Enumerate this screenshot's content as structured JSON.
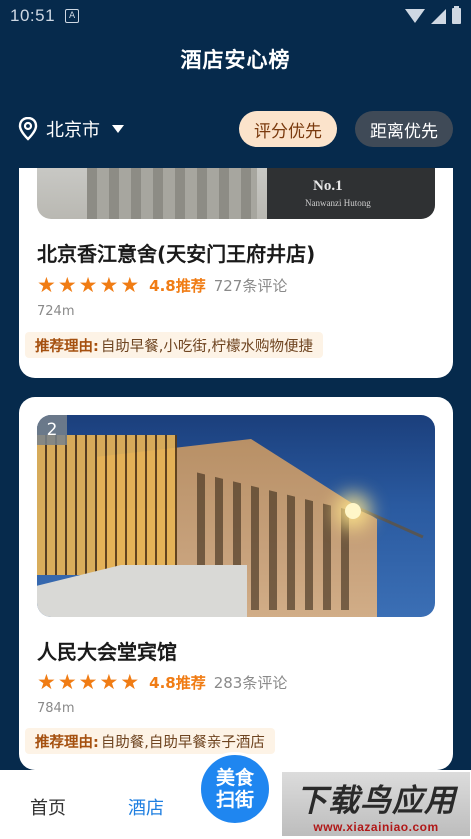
{
  "status_bar": {
    "time": "10:51",
    "a_icon": "A"
  },
  "page_title": "酒店安心榜",
  "filter": {
    "city": "北京市",
    "sort_options": [
      "评分优先",
      "距离优先"
    ],
    "active_sort": "评分优先"
  },
  "hotels": [
    {
      "photo_text": "No.1",
      "photo_subtext": "Nanwanzi Hutong",
      "name": "北京香江意舍(天安门王府井店)",
      "rating_stars": 5,
      "score": "4.8推荐",
      "reviews": "727条评论",
      "distance": "724m",
      "reason_label": "推荐理由:",
      "reason": "自助早餐,小吃街,柠檬水购物便捷"
    },
    {
      "rank": "2",
      "name": "人民大会堂宾馆",
      "rating_stars": 5,
      "score": "4.8推荐",
      "reviews": "283条评论",
      "distance": "784m",
      "reason_label": "推荐理由:",
      "reason": "自助餐,自助早餐亲子酒店"
    }
  ],
  "bottom_nav": {
    "home": "首页",
    "hotel": "酒店",
    "food_line1": "美食",
    "food_line2": "扫街"
  },
  "watermark": {
    "main": "下载鸟应用",
    "sub": "www.xiazainiao.com"
  },
  "colors": {
    "background": "#062a4c",
    "accent_orange": "#f07c14",
    "active_blue": "#1f7fe0"
  }
}
